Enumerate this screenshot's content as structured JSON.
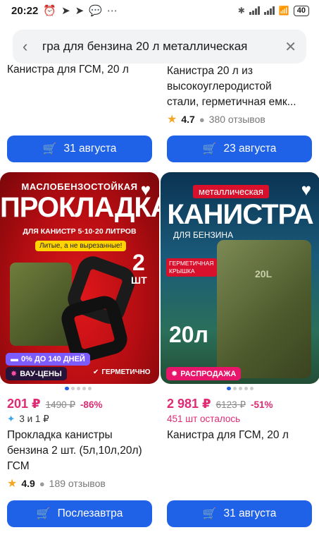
{
  "status": {
    "time": "20:22",
    "battery": "40"
  },
  "search": {
    "query": "гра для бензина 20 л металлическая"
  },
  "top_left": {
    "title_tail": "Канистра для ГСМ, 20 л",
    "button": "31 августа"
  },
  "top_right": {
    "title_tail_1": "Канистра 20 л из",
    "title_tail_2": "высокоуглеродистой",
    "title_tail_3": "стали, герметичная емк...",
    "rating": "4.7",
    "reviews": "380 отзывов",
    "button": "23 августа"
  },
  "left_product": {
    "image": {
      "headline_1": "МАСЛОБЕНЗОСТОЙКАЯ",
      "headline_2": "ПРОКЛАДКА",
      "headline_3": "ДЛЯ КАНИСТР 5·10·20 ЛИТРОВ",
      "note": "Литые, а не вырезанные!",
      "qty_num": "2",
      "qty_unit": "ШТ",
      "promo": "0% ДО 140 ДНЕЙ",
      "badge": "ВАУ-ЦЕНЫ",
      "feature": "ГЕРМЕТИЧНО"
    },
    "price": "201 ₽",
    "old_price": "1490 ₽",
    "discount": "-86%",
    "installment": "3 и 1 ₽",
    "title_1": "Прокладка канистры",
    "title_2": "бензина 2 шт. (5л,10л,20л)",
    "title_3": "ГСМ",
    "rating": "4.9",
    "reviews": "189 отзывов",
    "button": "Послезавтра"
  },
  "right_product": {
    "image": {
      "tag": "металлическая",
      "headline": "КАНИСТРА",
      "sub": "ДЛЯ БЕНЗИНА",
      "side_note_1": "ГЕРМЕТИЧНАЯ",
      "side_note_2": "КРЫШКА",
      "volume": "20л",
      "can_label": "20L",
      "badge": "РАСПРОДАЖА"
    },
    "price": "2 981 ₽",
    "old_price": "6123 ₽",
    "discount": "-51%",
    "stock": "451 шт осталось",
    "title": "Канистра для ГСМ, 20 л",
    "button": "31 августа"
  },
  "colors": {
    "accent": "#1f62e8",
    "price": "#e02a73",
    "star": "#f5a623"
  }
}
